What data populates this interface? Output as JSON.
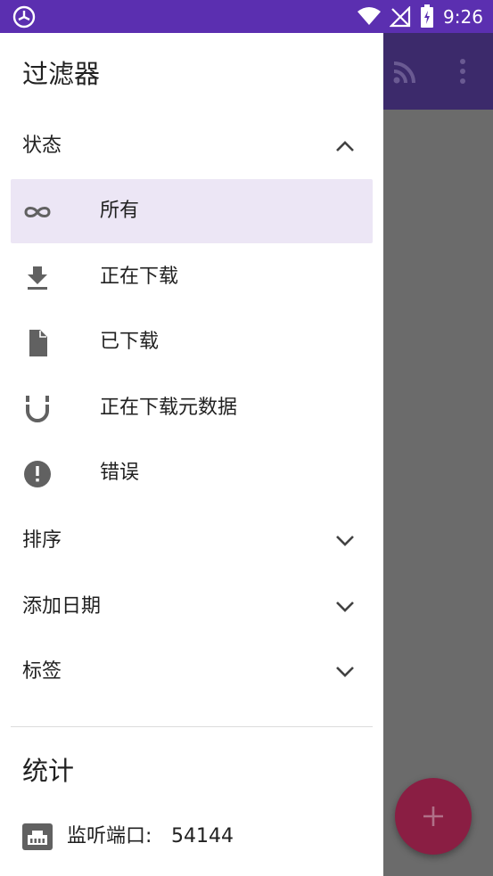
{
  "status_bar": {
    "time": "9:26"
  },
  "drawer": {
    "title": "过滤器",
    "sections": {
      "status": {
        "label": "状态",
        "expanded": true
      },
      "sort": {
        "label": "排序"
      },
      "date_added": {
        "label": "添加日期"
      },
      "tags": {
        "label": "标签"
      }
    },
    "status_items": [
      {
        "label": "所有",
        "icon": "infinity-icon",
        "selected": true
      },
      {
        "label": "正在下载",
        "icon": "download-icon"
      },
      {
        "label": "已下载",
        "icon": "file-icon"
      },
      {
        "label": "正在下载元数据",
        "icon": "magnet-icon"
      },
      {
        "label": "错误",
        "icon": "error-icon"
      }
    ],
    "stats": {
      "title": "统计",
      "port_label": "监听端口:",
      "port_value": "54144"
    }
  },
  "colors": {
    "status_bar": "#5b2fb0",
    "toolbar_dimmed": "#3c2a6b",
    "fab": "#8a1e43",
    "selected_item": "#ece6f5",
    "icon_gray": "#616161"
  }
}
